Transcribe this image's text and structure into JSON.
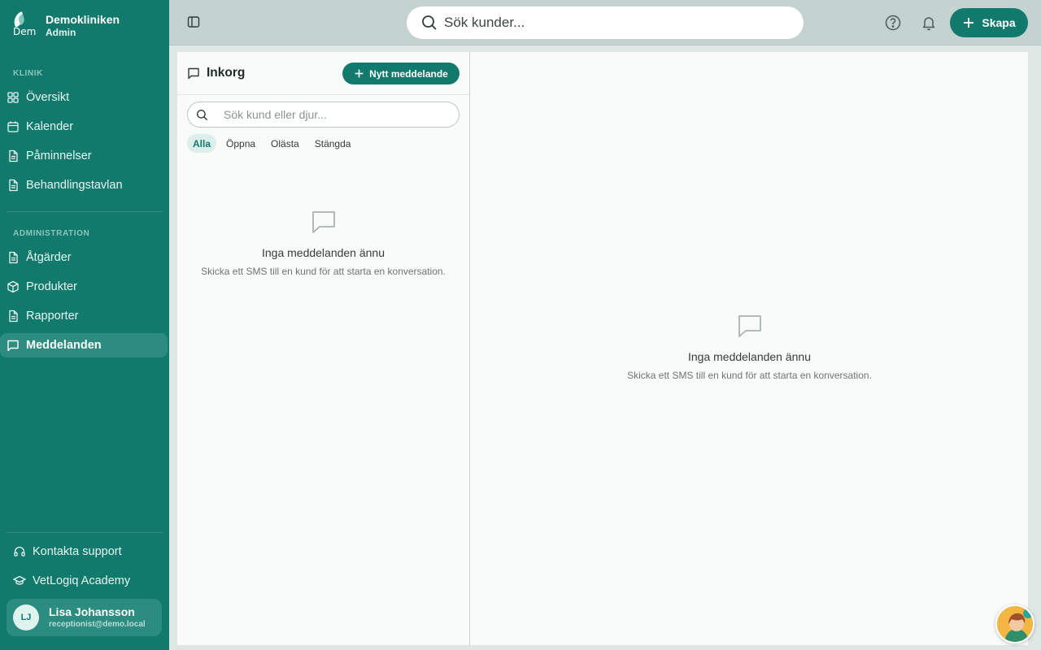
{
  "brand": {
    "name": "Demokliniken",
    "role": "Admin",
    "logo_text": "Dem"
  },
  "sidebar": {
    "section_clinic": "KLINIK",
    "clinic_items": [
      {
        "label": "Översikt",
        "icon": "grid-icon"
      },
      {
        "label": "Kalender",
        "icon": "calendar-icon"
      },
      {
        "label": "Påminnelser",
        "icon": "document-icon"
      },
      {
        "label": "Behandlingstavlan",
        "icon": "document-icon"
      }
    ],
    "section_admin": "ADMINISTRATION",
    "admin_items": [
      {
        "label": "Åtgärder",
        "icon": "document-icon"
      },
      {
        "label": "Produkter",
        "icon": "box-icon"
      },
      {
        "label": "Rapporter",
        "icon": "document-icon"
      },
      {
        "label": "Meddelanden",
        "icon": "chat-icon",
        "active": true
      }
    ],
    "footer_items": [
      {
        "label": "Kontakta support",
        "icon": "headset-icon"
      },
      {
        "label": "VetLogiq Academy",
        "icon": "graduation-cap-icon"
      }
    ],
    "user": {
      "initials": "LJ",
      "name": "Lisa Johansson",
      "email": "receptionist@demo.local"
    }
  },
  "topbar": {
    "search_placeholder": "Sök kunder...",
    "create_label": "Skapa"
  },
  "inbox": {
    "title": "Inkorg",
    "new_message_label": "Nytt meddelande",
    "search_placeholder": "Sök kund eller djur...",
    "filters": [
      "Alla",
      "Öppna",
      "Olästa",
      "Stängda"
    ],
    "active_filter": "Alla",
    "empty_title": "Inga meddelanden ännu",
    "empty_subtitle": "Skicka ett SMS till en kund för att starta en konversation."
  },
  "conversation": {
    "empty_title": "Inga meddelanden ännu",
    "empty_subtitle": "Skicka ett SMS till en kund för att starta en konversation."
  },
  "colors": {
    "sidebar": "#117a6c",
    "accent": "#117a6c",
    "active_item": "#2c8c7f",
    "topbar": "#c4d3d0"
  }
}
